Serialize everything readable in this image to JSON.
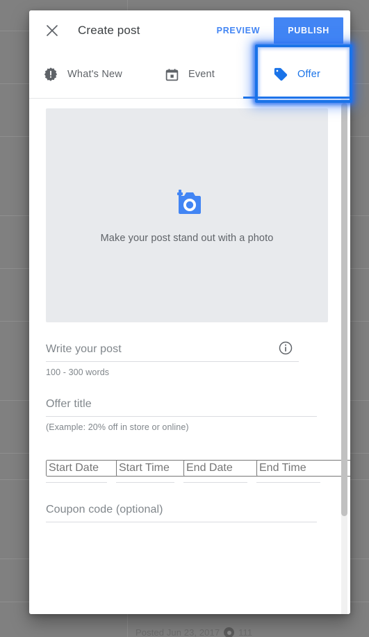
{
  "background": {
    "posted_text": "Posted Jun 23, 2017",
    "views_count": "111",
    "eye_icon": "eye-icon",
    "scrim_color": "#808080"
  },
  "dialog": {
    "header": {
      "close_icon": "close-icon",
      "title": "Create post",
      "preview_label": "PREVIEW",
      "publish_label": "PUBLISH",
      "publish_color": "#4285F4",
      "preview_color": "#4285F4"
    },
    "tabs": [
      {
        "label": "What's New",
        "icon": "whats-new-badge-icon",
        "active": false
      },
      {
        "label": "Event",
        "icon": "calendar-icon",
        "active": false
      },
      {
        "label": "Offer",
        "icon": "tag-icon",
        "active": true
      }
    ],
    "active_tab_color": "#1A73E8",
    "photo": {
      "icon": "add-photo-camera-icon",
      "caption": "Make your post stand out with a photo",
      "background_color": "#E8EAED"
    },
    "fields": {
      "post": {
        "placeholder": "Write your post",
        "helper": "100 - 300 words",
        "info_icon": "info-icon"
      },
      "offer_title": {
        "placeholder": "Offer title",
        "helper": "(Example: 20% off in store or online)"
      },
      "start_date": {
        "placeholder": "Start Date"
      },
      "start_time": {
        "placeholder": "Start Time"
      },
      "end_date": {
        "placeholder": "End Date"
      },
      "end_time": {
        "placeholder": "End Time"
      },
      "coupon": {
        "placeholder": "Coupon code (optional)"
      }
    },
    "scrollbar": {
      "name": "vertical-scrollbar"
    }
  },
  "annotation": {
    "target": "offer-tab",
    "color": "#1A73E8"
  }
}
